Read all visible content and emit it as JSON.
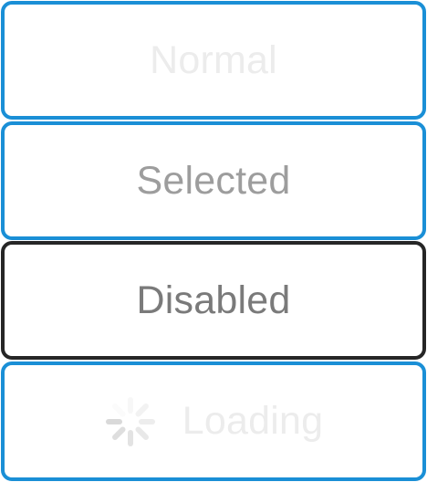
{
  "buttons": {
    "normal": {
      "label": "Normal"
    },
    "selected": {
      "label": "Selected"
    },
    "disabled": {
      "label": "Disabled"
    },
    "loading": {
      "label": "Loading",
      "icon": "spinner-icon"
    }
  },
  "colors": {
    "border_active": "#1a8fd6",
    "border_disabled": "#262626",
    "text_normal": "#ececec",
    "text_selected": "#9d9d9d",
    "text_disabled": "#7a7a7a"
  }
}
